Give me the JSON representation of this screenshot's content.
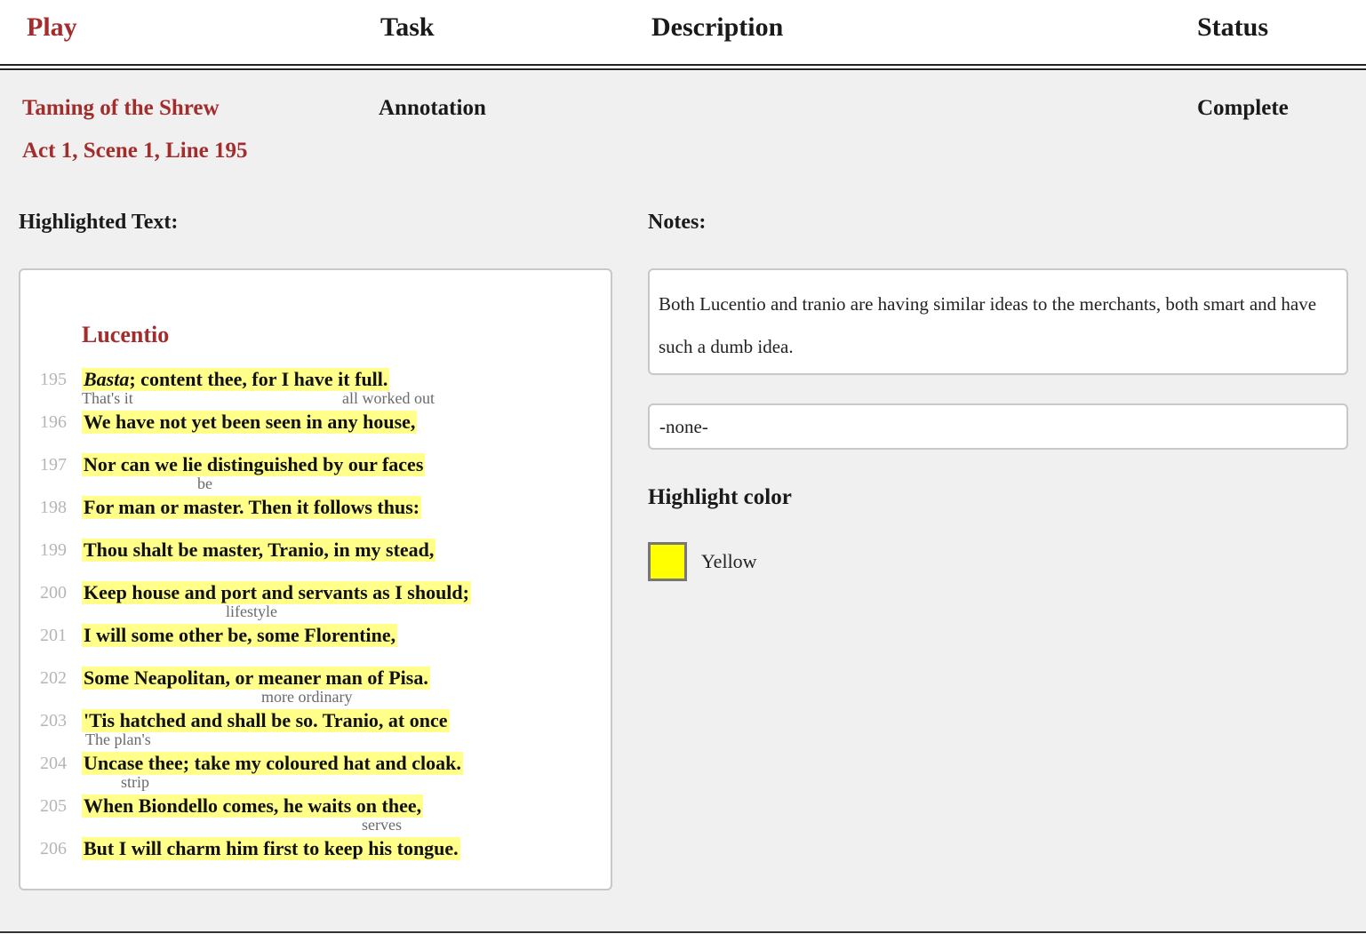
{
  "header": {
    "play": "Play",
    "task": "Task",
    "description": "Description",
    "status": "Status"
  },
  "row": {
    "play_title": "Taming of the Shrew",
    "location": "Act 1, Scene 1, Line 195",
    "task": "Annotation",
    "status": "Complete"
  },
  "highlighted": {
    "label": "Highlighted Text:",
    "speaker": "Lucentio",
    "lines": [
      {
        "num": "195",
        "first_word": "Basta",
        "text": "; content thee, for I have it full."
      },
      {
        "num": "196",
        "text": "We have not yet been seen in any house,"
      },
      {
        "num": "197",
        "text": "Nor can we lie distinguished by our faces"
      },
      {
        "num": "198",
        "text": "For man or master. Then it follows thus:"
      },
      {
        "num": "199",
        "text": "Thou shalt be master, Tranio, in my stead,"
      },
      {
        "num": "200",
        "text": "Keep house and port and servants as I should;"
      },
      {
        "num": "201",
        "text": "I will some other be, some Florentine,"
      },
      {
        "num": "202",
        "text": "Some Neapolitan, or meaner man of Pisa."
      },
      {
        "num": "203",
        "text": "'Tis hatched and shall be so. Tranio, at once"
      },
      {
        "num": "204",
        "text": "Uncase thee; take my coloured hat and cloak."
      },
      {
        "num": "205",
        "text": "When Biondello comes, he waits on thee,"
      },
      {
        "num": "206",
        "text": "But I will charm him first to keep his tongue."
      }
    ],
    "glosses": {
      "thats_it": "That's it",
      "all_worked_out": "all worked out",
      "be": "be",
      "lifestyle": "lifestyle",
      "more_ordinary": "more ordinary",
      "the_plans": "The plan's",
      "strip": "strip",
      "serves": "serves"
    }
  },
  "notes": {
    "label": "Notes:",
    "text": "Both Lucentio and tranio are having similar ideas to the merchants, both smart and have such a dumb idea.",
    "tag_value": "-none-"
  },
  "highlight": {
    "label": "Highlight color",
    "color_name": "Yellow",
    "color_hex": "#ffff00",
    "highlight_bg": "#ffff8a",
    "accent": "#a32d2d"
  }
}
